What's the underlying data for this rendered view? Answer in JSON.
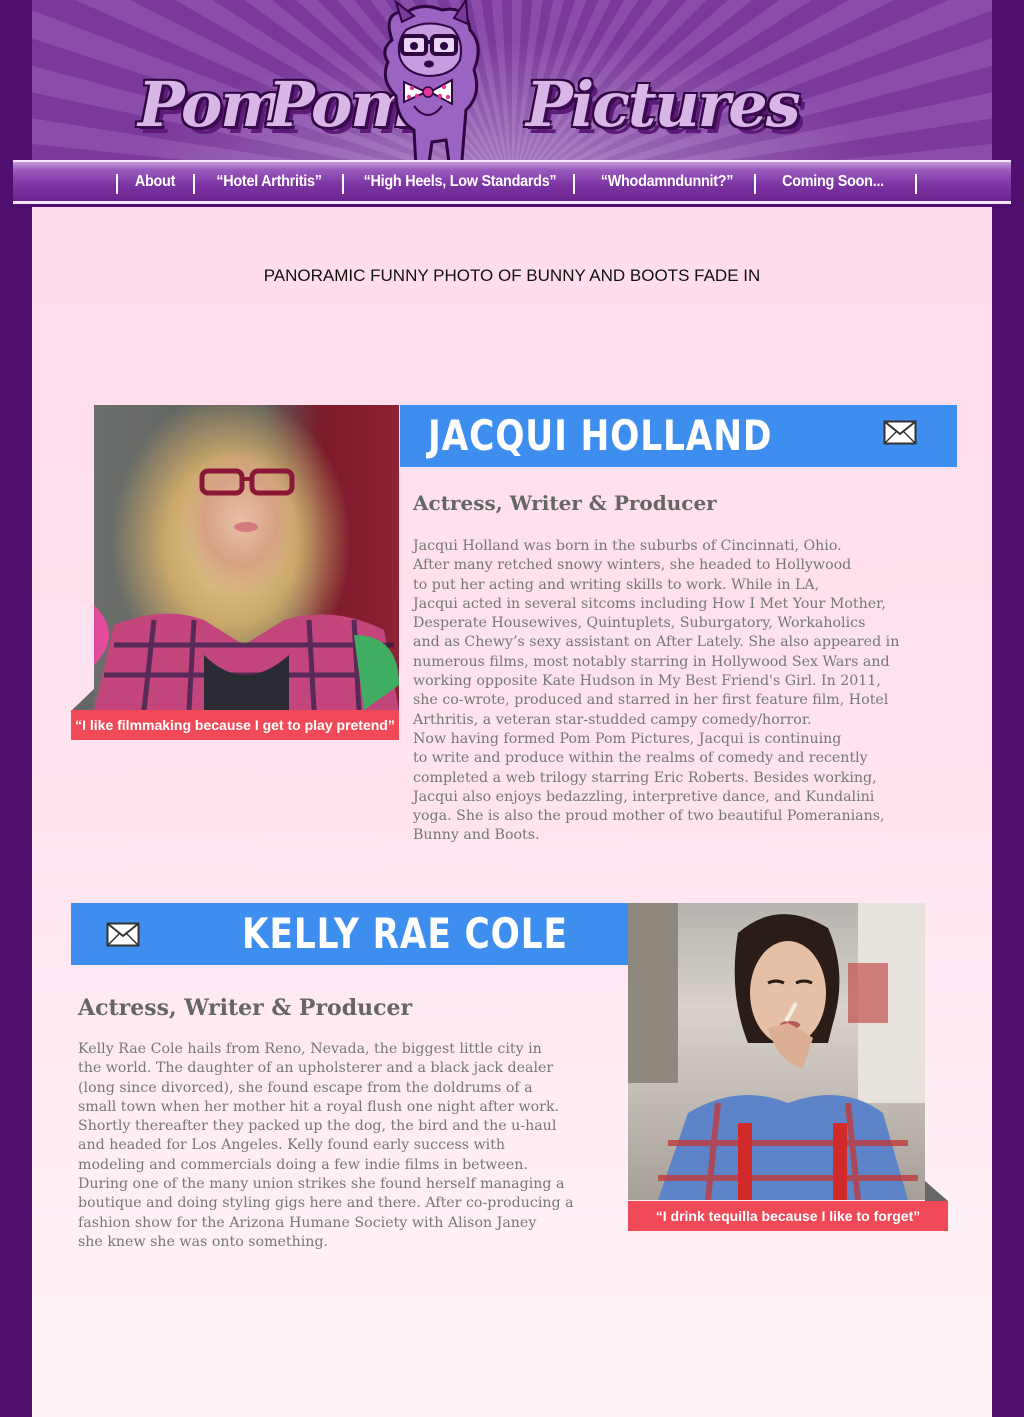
{
  "brand": {
    "word1": "Pom",
    "word2": "Pom",
    "word3": "Pictures"
  },
  "nav": {
    "items": [
      {
        "label": "About"
      },
      {
        "label": "“Hotel Arthritis”"
      },
      {
        "label": "“High Heels, Low Standards”"
      },
      {
        "label": "“Whodamndunnit?”"
      },
      {
        "label": "Coming Soon..."
      }
    ]
  },
  "banner": {
    "text": "PANORAMIC FUNNY PHOTO OF BUNNY AND BOOTS FADE IN"
  },
  "profiles": [
    {
      "name": "JACQUI  HOLLAND",
      "role": "Actress, Writer & Producer",
      "quote": "“I like filmmaking because I get to play pretend”",
      "bio": "Jacqui Holland was born in the suburbs of Cincinnati, Ohio.\nAfter many retched snowy winters, she headed to Hollywood\nto  put her acting and writing skills to work. While in LA,\nJacqui acted  in several sitcoms including How I Met Your Mother,\nDesperate Housewives, Quintuplets, Suburgatory, Workaholics\nand as Chewy’s sexy assistant on After Lately.  She also appeared in\nnumerous films, most notably starring in Hollywood Sex Wars and\nworking opposite Kate Hudson in My Best Friend's Girl.  In 2011,\nshe co-wrote, produced and starred in her first feature film, Hotel\nArthritis, a veteran star-studded campy comedy/horror.\nNow having formed Pom Pom Pictures, Jacqui is continuing\nto write and produce within the realms of comedy and recently\ncompleted a web trilogy starring Eric Roberts. Besides  working,\nJacqui also enjoys bedazzling, interpretive dance, and Kundalini\nyoga.  She is also the proud mother of two beautiful Pomeranians,\nBunny and Boots."
    },
    {
      "name": "KELLY  RAE  COLE",
      "role": "Actress, Writer & Producer",
      "quote": "“I drink tequilla because I like to forget”",
      "bio": "Kelly Rae Cole hails from Reno, Nevada, the biggest little city in\n the world. The daughter of an upholsterer and a black jack dealer\n (long since divorced), she found escape from the doldrums of a\nsmall town when her mother hit a royal flush one night after work.\nShortly thereafter they packed up the dog, the bird and the u-haul\nand headed for Los Angeles. Kelly found early success with\nmodeling and commercials doing a few indie films in between.\nDuring one of the many union strikes she found herself managing a\nboutique and doing styling gigs here and there. After co-producing a\nfashion show for the Arizona Humane Society with Alison Janey\nshe knew she was onto something."
    }
  ],
  "colors": {
    "frame": "#4f0f6f",
    "name_bar": "#3e8ef0",
    "quote_bar": "#f04a58",
    "content_bg": "#ffdcec"
  },
  "icons": {
    "contact": "envelope-icon",
    "mascot": "pomeranian-mascot-icon"
  }
}
